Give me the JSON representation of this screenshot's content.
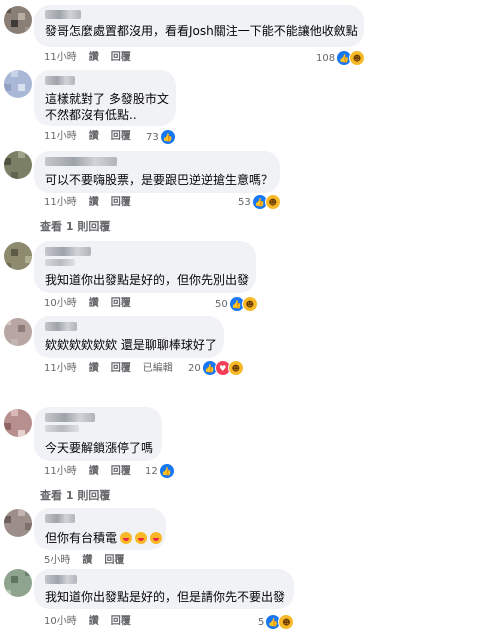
{
  "comments": [
    {
      "text": "發哥怎麼處置都沒用，看看Josh關注一下能不能讓他收斂點",
      "time": "11小時",
      "like": "讚",
      "reply": "回覆",
      "reactions": "108"
    },
    {
      "lines": [
        "這樣就對了 多發股市文",
        "不然都沒有低點.."
      ],
      "time": "11小時",
      "like": "讚",
      "reply": "回覆",
      "reactions": "73"
    },
    {
      "text": "可以不要嗨股票，是要跟巴逆逆搶生意嗎？",
      "time": "11小時",
      "like": "讚",
      "reply": "回覆",
      "reactions": "53",
      "view_replies": "查看 1 則回覆"
    },
    {
      "text": "我知道你出發點是好的，但你先別出發",
      "time": "10小時",
      "like": "讚",
      "reply": "回覆",
      "reactions": "50"
    },
    {
      "text": "欸欸欸欸欸欸 還是聊聊棒球好了",
      "time": "11小時",
      "like": "讚",
      "reply": "回覆",
      "edited": "已編輯",
      "reactions": "20"
    },
    {
      "text": "今天要解鎖漲停了嗎",
      "time": "11小時",
      "like": "讚",
      "reply": "回覆",
      "reactions": "12",
      "view_replies": "查看 1 則回覆"
    },
    {
      "text": "但你有台積電",
      "time": "5小時",
      "like": "讚",
      "reply": "回覆"
    },
    {
      "text": "我知道你出發點是好的，但是請你先不要出發",
      "time": "10小時",
      "like": "讚",
      "reply": "回覆",
      "reactions": "5"
    }
  ],
  "icons": {
    "like": "like-reaction-icon",
    "haha": "haha-reaction-icon",
    "love": "love-reaction-icon"
  },
  "colors": {
    "bubble": "#f0f2f5",
    "meta_text": "#65676b",
    "like_blue": "#1877f2",
    "haha_yellow": "#f7b928",
    "love_red": "#f33e58"
  }
}
